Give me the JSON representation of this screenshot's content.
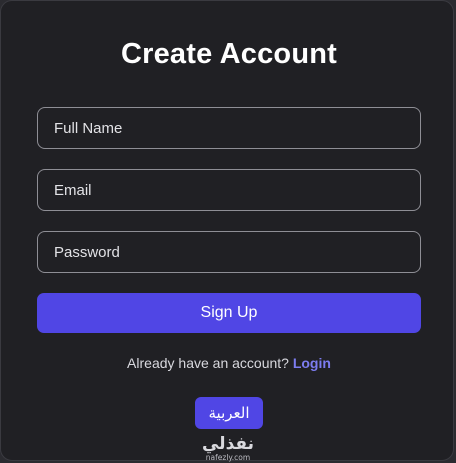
{
  "form": {
    "title": "Create Account",
    "fields": {
      "full_name_placeholder": "Full Name",
      "email_placeholder": "Email",
      "password_placeholder": "Password"
    },
    "signup_label": "Sign Up",
    "login_prompt": "Already have an account?",
    "login_link": "Login",
    "language_button": "العربية"
  },
  "watermark": {
    "logo_text": "نفذلي",
    "domain_text": "nafezly.com"
  },
  "colors": {
    "accent": "#5046e5",
    "link": "#7c7cf0",
    "card_bg": "#202024"
  }
}
